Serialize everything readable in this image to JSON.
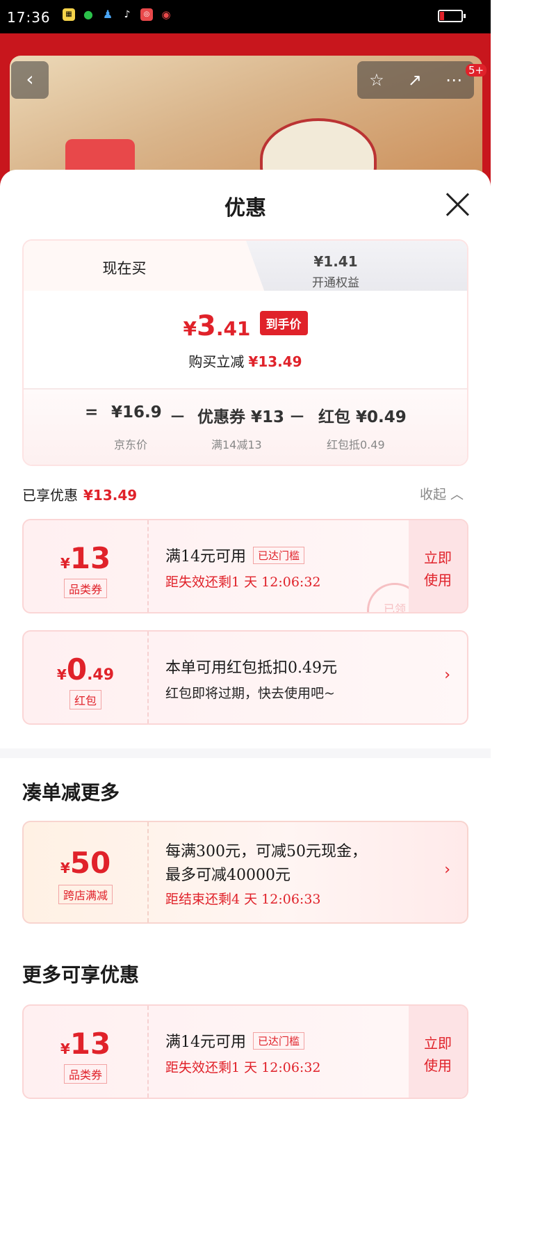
{
  "status_bar": {
    "time": "17:36"
  },
  "background_page": {
    "badge": "5+"
  },
  "sheet": {
    "title": "优惠",
    "tabs": {
      "now_label": "现在买",
      "vip_price": "¥1.41",
      "vip_label": "开通权益"
    },
    "final_price": {
      "yen": "¥",
      "integer": "3",
      "decimal": ".41",
      "tag": "到手价"
    },
    "saved": {
      "label": "购买立减",
      "amount": "¥13.49"
    },
    "formula": {
      "eq": "=",
      "items": [
        {
          "value": "¥16.9",
          "caption": "京东价"
        },
        {
          "op": "－",
          "value": "优惠券 ¥13",
          "caption": "满14减13"
        },
        {
          "op": "－",
          "value": "红包 ¥0.49",
          "caption": "红包抵0.49"
        }
      ]
    },
    "enjoyed": {
      "label": "已享优惠",
      "amount": "¥13.49",
      "collapse": "收起 ︿"
    },
    "coupons": [
      {
        "yen": "¥",
        "amount": "13",
        "decimal": "",
        "kind": "品类券",
        "line1": "满14元可用",
        "chip": "已达门槛",
        "line2": "距失效还剩1 天 12:06:32",
        "action": "立即使用",
        "stamp": "已领"
      },
      {
        "yen": "¥",
        "amount": "0",
        "decimal": ".49",
        "kind": "红包",
        "line1": "本单可用红包抵扣0.49元",
        "line2": "红包即将过期，快去使用吧~",
        "chev": "›"
      }
    ],
    "more_section": {
      "title": "凑单减更多",
      "card": {
        "yen": "¥",
        "amount": "50",
        "kind": "跨店满减",
        "line1": "每满300元，可减50元现金，",
        "line1b": "最多可减40000元",
        "line2": "距结束还剩4 天 12:06:33",
        "chev": "›"
      }
    },
    "extra_section": {
      "title": "更多可享优惠",
      "card": {
        "yen": "¥",
        "amount": "13",
        "kind": "品类券",
        "line1": "满14元可用",
        "chip": "已达门槛",
        "line2": "距失效还剩1 天 12:06:32",
        "action": "立即使用"
      }
    }
  }
}
